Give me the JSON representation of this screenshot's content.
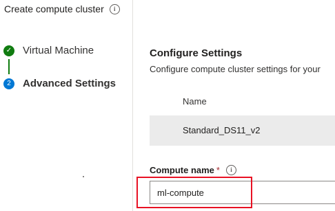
{
  "header": {
    "title": "Create compute cluster",
    "info_icon": "info-icon"
  },
  "stepper": {
    "steps": [
      {
        "label": "Virtual Machine",
        "status": "completed",
        "icon": "check-icon",
        "glyph": "✓"
      },
      {
        "label": "Advanced Settings",
        "status": "active",
        "number": "2"
      }
    ]
  },
  "main": {
    "section_title": "Configure Settings",
    "section_description": "Configure compute cluster settings for your",
    "vm_table": {
      "column_header": "Name",
      "selected_vm": "Standard_DS11_v2"
    },
    "compute_name": {
      "label": "Compute name",
      "required_marker": "*",
      "value": "ml-compute"
    }
  },
  "colors": {
    "completed": "#107c10",
    "active": "#0078d4",
    "highlight": "#e81123",
    "required": "#a4262c",
    "row_background": "#ebebeb"
  }
}
